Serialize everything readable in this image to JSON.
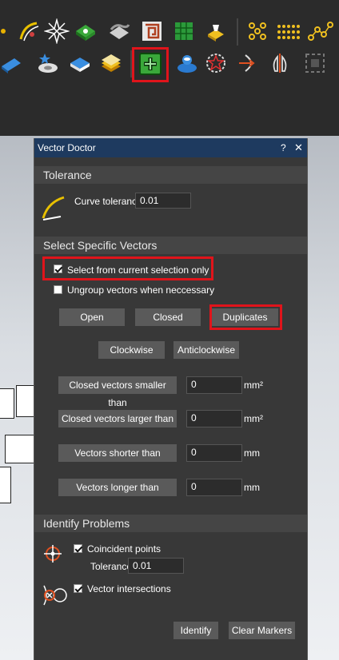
{
  "panel": {
    "title": "Vector Doctor",
    "help_label": "?",
    "close_label": "✕"
  },
  "tolerance": {
    "heading": "Tolerance",
    "curve_label": "Curve tolerance",
    "curve_value": "0.01"
  },
  "select": {
    "heading": "Select Specific Vectors",
    "current_selection_label": "Select from current selection only",
    "current_selection_checked": true,
    "ungroup_label": "Ungroup vectors when neccessary",
    "ungroup_checked": false,
    "open_label": "Open",
    "closed_label": "Closed",
    "duplicates_label": "Duplicates",
    "clockwise_label": "Clockwise",
    "anticlockwise_label": "Anticlockwise",
    "closed_smaller_label": "Closed vectors smaller than",
    "closed_smaller_value": "0",
    "closed_larger_label": "Closed vectors larger than",
    "closed_larger_value": "0",
    "shorter_label": "Vectors shorter than",
    "shorter_value": "0",
    "longer_label": "Vectors longer than",
    "longer_value": "0",
    "unit_area": "mm²",
    "unit_length": "mm"
  },
  "problems": {
    "heading": "Identify Problems",
    "coincident_label": "Coincident points",
    "coincident_checked": true,
    "tolerance_label": "Tolerance",
    "tolerance_value": "0.01",
    "intersections_label": "Vector intersections",
    "intersections_checked": true,
    "identify_label": "Identify",
    "clear_label": "Clear Markers"
  },
  "toolbar_icons": [
    "curve-tool-icon",
    "star-burst-icon",
    "green-diamond-icon",
    "weave-icon",
    "spiral-tile-icon",
    "green-grid-icon",
    "lamp-icon",
    "node-path-icon",
    "dotted-wave-icon",
    "node-chain-icon",
    "blue-plate-icon",
    "star-base-icon",
    "diamond-plate-icon",
    "layer-stack-icon",
    "vector-doctor-icon",
    "blue-bowl-icon",
    "star-ring-icon",
    "offset-arrow-icon",
    "mirror-icon",
    "dashed-box-icon"
  ],
  "colors": {
    "accent_red": "#e0141b",
    "title_bar": "#1e3a5f",
    "panel_bg": "#383838",
    "green_active": "#3aa83a"
  }
}
